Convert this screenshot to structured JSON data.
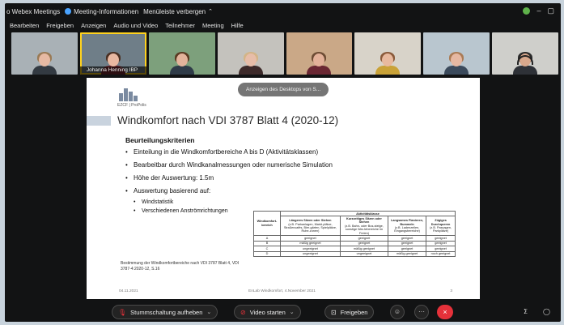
{
  "titlebar": {
    "app_label": "o Webex Meetings",
    "meeting_info_label": "Meeting-Informationen",
    "hide_menu_label": "Menüleiste verbergen"
  },
  "menubar": {
    "items": [
      "Bearbeiten",
      "Freigeben",
      "Anzeigen",
      "Audio und Video",
      "Teilnehmer",
      "Meeting",
      "Hilfe"
    ]
  },
  "participants": [
    {
      "name": "",
      "bg": "#a9b1b6",
      "skin": "#e6b9a3",
      "hair": "#9a7a55",
      "shirt": "#333a42"
    },
    {
      "name": "Johanna Henning IBP",
      "bg": "#6f7e88",
      "skin": "#e9b8a1",
      "hair": "#4a2f22",
      "shirt": "#7b2a32",
      "active": true
    },
    {
      "name": "",
      "bg": "#7da07c",
      "skin": "#e3b39b",
      "hair": "#5a3a22",
      "shirt": "#2f3b48"
    },
    {
      "name": "",
      "bg": "#c4c2bd",
      "skin": "#e7bda9",
      "hair": "#d3b487",
      "shirt": "#3d2a2a"
    },
    {
      "name": "",
      "bg": "#caa887",
      "skin": "#e3b199",
      "hair": "#6d4c34",
      "shirt": "#6a2733"
    },
    {
      "name": "",
      "bg": "#d8d3c9",
      "skin": "#e8b99e",
      "hair": "#8a5a3a",
      "shirt": "#c9a238"
    },
    {
      "name": "",
      "bg": "#b9c6cf",
      "skin": "#e6b8a2",
      "hair": "#aa7b55",
      "shirt": "#3b4a5c"
    },
    {
      "name": "",
      "bg": "#cfcfcb",
      "skin": "#d8a88c",
      "hair": "#2a2a2a",
      "shirt": "#2e3137",
      "headset": true
    }
  ],
  "share_pill": "Anzeigen des Desktops von S...",
  "slide": {
    "logo_text": "EZCF | ProPolis",
    "title": "Windkomfort nach VDI 3787 Blatt 4 (2020-12)",
    "section": "Beurteilungskriterien",
    "bullets": [
      "Einteilung in die Windkomfortbereiche A bis D (Aktivitätsklassen)",
      "Bearbeitbar durch Windkanalmessungen oder numerische Simulation",
      "Höhe der Auswertung: 1.5m",
      "Auswertung basierend auf:"
    ],
    "sub_bullets": [
      "Windstatistik",
      "Verschiedenen Anströmrichtungen"
    ],
    "caption": "Bestimmung der Windkomfortbereiche nach VDI 3787 Blatt 4, VDI 3787-4:2020-12, S.16",
    "footer_left": "04.11.2021",
    "footer_center": "EnLab Windkomfort, 4.November 2021",
    "footer_right": "3",
    "table": {
      "group_header": "Aktivitätsklasse",
      "row_header": "Windkomfort-bereich",
      "columns": [
        {
          "title": "Längeres Sitzen oder Stehen",
          "note": "(z.B. Parkanlagen, Markt-plätze, Straßencafés, Bier-gärten, Spielplätze, Ruhe-zonen)"
        },
        {
          "title": "Kurzzeitiges Sitzen oder Stehen",
          "note": "(z.B. Bahn- oder Bus-steige, sonstige War-tebereiche im Freien)"
        },
        {
          "title": "Langsames Flanieren, Bummeln",
          "note": "(z.B. Ladenzeilen, Eingangsbereiche)"
        },
        {
          "title": "Zügiges Durchqueren",
          "note": "(z.B. Passagen, Parkplätze)"
        }
      ],
      "rows": [
        {
          "label": "A",
          "cells": [
            "geeignet",
            "geeignet",
            "geeignet",
            "geeignet"
          ]
        },
        {
          "label": "B",
          "cells": [
            "mäßig geeignet",
            "geeignet",
            "geeignet",
            "geeignet"
          ]
        },
        {
          "label": "C",
          "cells": [
            "ungeeignet",
            "mäßig geeignet",
            "geeignet",
            "geeignet"
          ]
        },
        {
          "label": "D",
          "cells": [
            "ungeeignet",
            "ungeeignet",
            "mäßig geeignet",
            "noch geeignet"
          ]
        }
      ]
    }
  },
  "controls": {
    "mute_label": "Stummschaltung aufheben",
    "video_label": "Video starten",
    "share_label": "Freigeben",
    "more_label": "···",
    "end_label": "×",
    "mic_icon": "🎙",
    "video_icon": "⊘",
    "share_icon": "⊡",
    "reactions_icon": "☺"
  }
}
